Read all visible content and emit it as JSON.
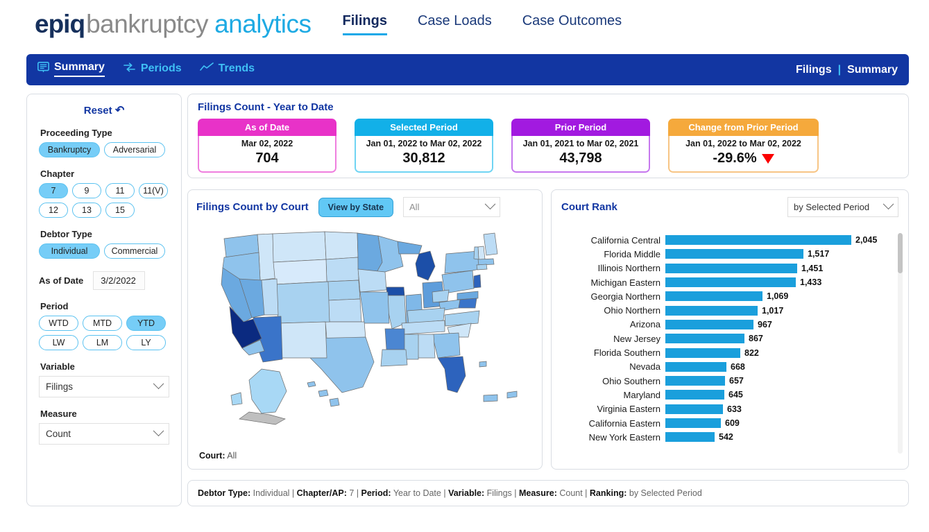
{
  "brand": {
    "part1": "epiq",
    "part2": "bankruptcy",
    "part3": "analytics"
  },
  "main_tabs": [
    {
      "label": "Filings",
      "active": true
    },
    {
      "label": "Case Loads",
      "active": false
    },
    {
      "label": "Case Outcomes",
      "active": false
    }
  ],
  "nav": {
    "items": [
      {
        "label": "Summary",
        "icon": "summary-panel-icon",
        "active": true
      },
      {
        "label": "Periods",
        "icon": "periods-arrows-icon",
        "active": false
      },
      {
        "label": "Trends",
        "icon": "trend-line-icon",
        "active": false
      }
    ],
    "breadcrumb_left": "Filings",
    "breadcrumb_sep": "|",
    "breadcrumb_right": "Summary"
  },
  "sidebar": {
    "reset_label": "Reset",
    "reset_icon": "undo-arrow-icon",
    "proceeding_type": {
      "label": "Proceeding Type",
      "options": [
        {
          "label": "Bankruptcy",
          "selected": true
        },
        {
          "label": "Adversarial",
          "selected": false
        }
      ]
    },
    "chapter": {
      "label": "Chapter",
      "options": [
        {
          "label": "7",
          "selected": true
        },
        {
          "label": "9",
          "selected": false
        },
        {
          "label": "11",
          "selected": false
        },
        {
          "label": "11(V)",
          "selected": false
        },
        {
          "label": "12",
          "selected": false
        },
        {
          "label": "13",
          "selected": false
        },
        {
          "label": "15",
          "selected": false
        }
      ]
    },
    "debtor_type": {
      "label": "Debtor Type",
      "options": [
        {
          "label": "Individual",
          "selected": true
        },
        {
          "label": "Commercial",
          "selected": false
        }
      ]
    },
    "as_of_date": {
      "label": "As of Date",
      "value": "3/2/2022"
    },
    "period": {
      "label": "Period",
      "options": [
        {
          "label": "WTD",
          "selected": false
        },
        {
          "label": "MTD",
          "selected": false
        },
        {
          "label": "YTD",
          "selected": true
        },
        {
          "label": "LW",
          "selected": false
        },
        {
          "label": "LM",
          "selected": false
        },
        {
          "label": "LY",
          "selected": false
        }
      ]
    },
    "variable": {
      "label": "Variable",
      "value": "Filings"
    },
    "measure": {
      "label": "Measure",
      "value": "Count"
    }
  },
  "kpi": {
    "title": "Filings Count - Year to Date",
    "cards": [
      {
        "header": "As of Date",
        "sub": "Mar 02, 2022",
        "value": "704",
        "color": "#e832c8",
        "border": "#ef7ede"
      },
      {
        "header": "Selected Period",
        "sub": "Jan 01, 2022 to Mar 02, 2022",
        "value": "30,812",
        "color": "#12b0e8",
        "border": "#6fd4f3"
      },
      {
        "header": "Prior Period",
        "sub": "Jan 01, 2021 to Mar 02, 2021",
        "value": "43,798",
        "color": "#a21ae0",
        "border": "#c678ee"
      },
      {
        "header": "Change from Prior Period",
        "sub": "Jan 01, 2022 to Mar 02, 2022",
        "value": "-29.6%",
        "color": "#f5a93c",
        "border": "#f7c585",
        "arrow": "down-triangle-icon"
      }
    ]
  },
  "map": {
    "title": "Filings Count by Court",
    "view_button": "View by State",
    "filter_value": "All",
    "footer_label": "Court:",
    "footer_value": "All"
  },
  "chart_data": {
    "type": "bar",
    "title": "Court Rank",
    "ranking_select": "by Selected Period",
    "orientation": "horizontal",
    "xlabel": "",
    "ylabel": "",
    "grid": false,
    "legend": false,
    "xlim": [
      0,
      2045
    ],
    "categories": [
      "California Central",
      "Florida Middle",
      "Illinois Northern",
      "Michigan Eastern",
      "Georgia Northern",
      "Ohio Northern",
      "Arizona",
      "New Jersey",
      "Florida Southern",
      "Nevada",
      "Ohio Southern",
      "Maryland",
      "Virginia Eastern",
      "California Eastern",
      "New York Eastern"
    ],
    "values": [
      2045,
      1517,
      1451,
      1433,
      1069,
      1017,
      967,
      867,
      822,
      668,
      657,
      645,
      633,
      609,
      542
    ],
    "value_labels": [
      "2,045",
      "1,517",
      "1,451",
      "1,433",
      "1,069",
      "1,017",
      "967",
      "867",
      "822",
      "668",
      "657",
      "645",
      "633",
      "609",
      "542"
    ],
    "bar_color": "#1a9fdc"
  },
  "status": {
    "segments": [
      {
        "key": "Debtor Type:",
        "val": "Individual"
      },
      {
        "key": "Chapter/AP:",
        "val": "7"
      },
      {
        "key": "Period:",
        "val": "Year to Date"
      },
      {
        "key": "Variable:",
        "val": "Filings"
      },
      {
        "key": "Measure:",
        "val": "Count"
      },
      {
        "key": "Ranking:",
        "val": "by Selected Period"
      }
    ]
  }
}
